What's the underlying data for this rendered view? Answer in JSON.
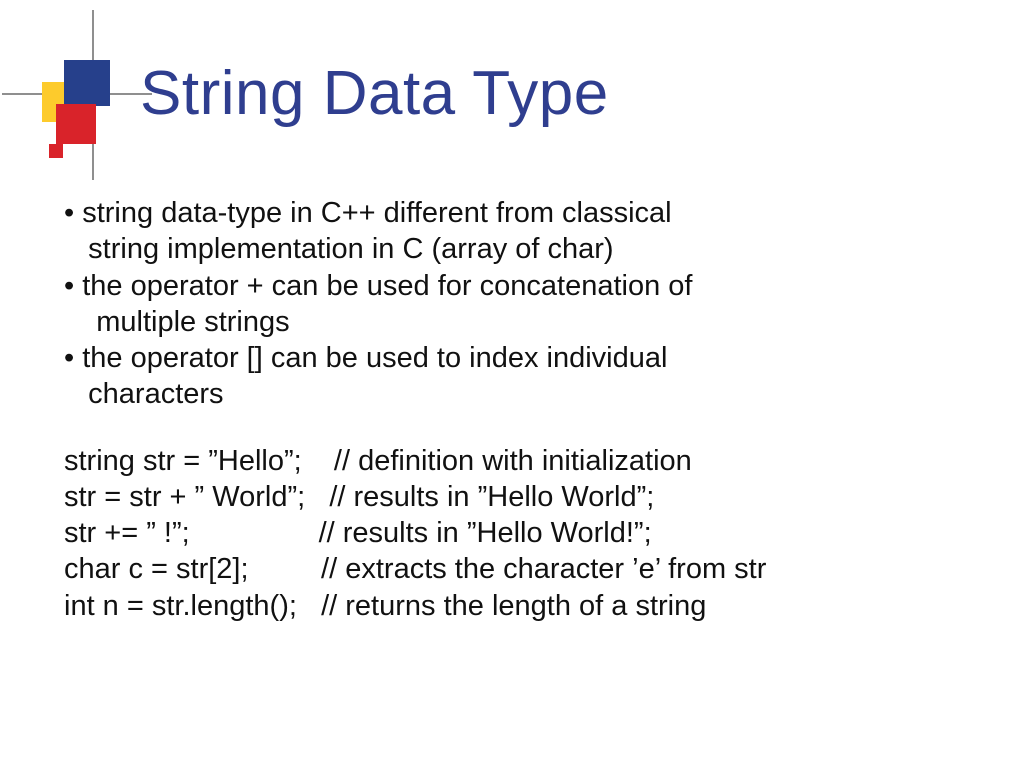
{
  "title": "String Data Type",
  "bullets": [
    {
      "prefix": "• ",
      "line1": "string data-type in C++ different from classical",
      "line2": "   string implementation in C (array of char)"
    },
    {
      "prefix": "• ",
      "line1": "the operator + can be used for concatenation of",
      "line2": "    multiple strings"
    },
    {
      "prefix": "• ",
      "line1": "the operator [] can be used to index individual",
      "line2": "   characters"
    }
  ],
  "code": [
    "string str = ”Hello”;    // definition with initialization",
    "str = str + ” World”;   // results in ”Hello World”;",
    "str += ” !”;                // results in ”Hello World!”;",
    "char c = str[2];         // extracts the character ’e’ from str",
    "int n = str.length();   // returns the length of a string"
  ]
}
